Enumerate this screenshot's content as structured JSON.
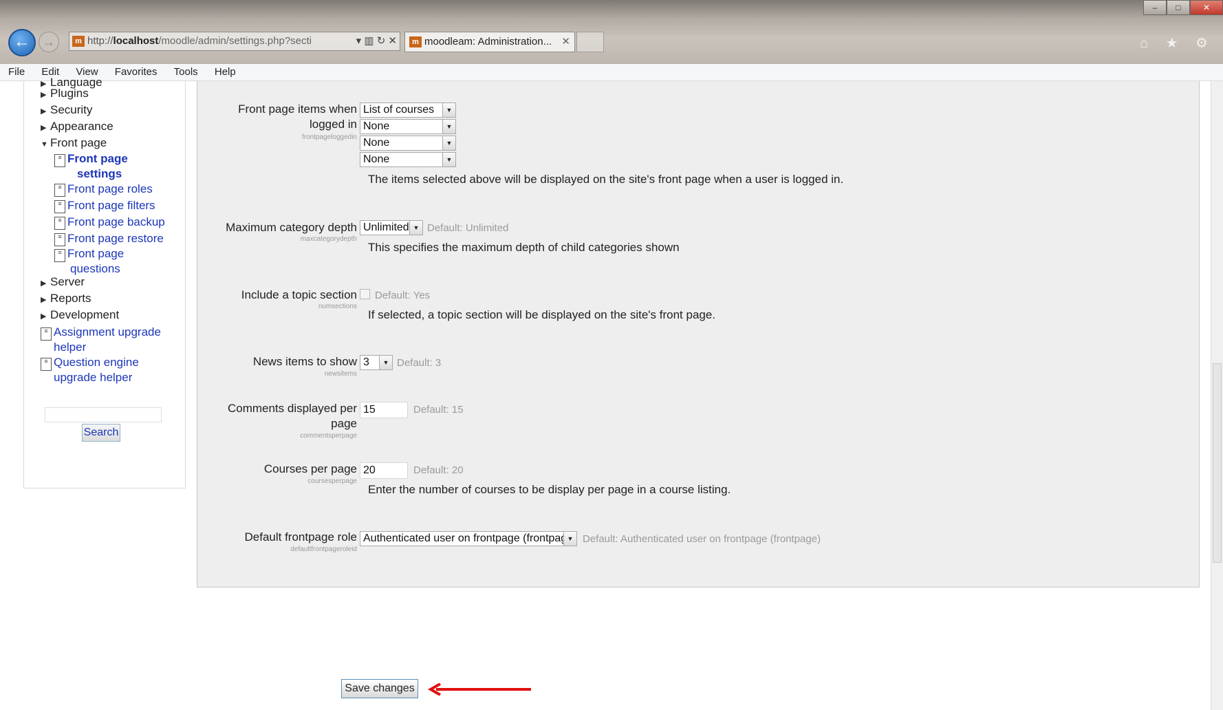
{
  "browser": {
    "address": {
      "url_prefix": "http://",
      "url_host": "localhost",
      "url_path": "/moodle/admin/settings.php?secti",
      "controls": "▾ ▥ ↻ ✕"
    },
    "tab": {
      "title": "moodleam: Administration...",
      "close": "✕"
    },
    "menu": [
      "File",
      "Edit",
      "View",
      "Favorites",
      "Tools",
      "Help"
    ],
    "tool_icons": "⌂ ★ ⚙"
  },
  "sidebar": {
    "items": [
      {
        "label": "Language"
      },
      {
        "label": "Plugins"
      },
      {
        "label": "Security"
      },
      {
        "label": "Appearance"
      },
      {
        "label": "Front page"
      },
      {
        "label": "Server"
      },
      {
        "label": "Reports"
      },
      {
        "label": "Development"
      }
    ],
    "front_page_children": [
      {
        "line1": "Front page",
        "line2": "settings"
      },
      {
        "line1": "Front page roles"
      },
      {
        "line1": "Front page filters"
      },
      {
        "line1": "Front page backup"
      },
      {
        "line1": "Front page restore"
      },
      {
        "line1": "Front page",
        "line2": "questions"
      }
    ],
    "tools": [
      {
        "line1": "Assignment upgrade",
        "line2": "helper"
      },
      {
        "line1": "Question engine",
        "line2": "upgrade helper"
      }
    ],
    "search_button": "Search"
  },
  "settings": {
    "frontpage_loggedin": {
      "label_line1": "Front page items when",
      "label_line2": "logged in",
      "name": "frontpageloggedin",
      "values": [
        "List of courses",
        "None",
        "None",
        "None"
      ],
      "description": "The items selected above will be displayed on the site's front page when a user is logged in."
    },
    "max_category_depth": {
      "label": "Maximum category depth",
      "name": "maxcategorydepth",
      "value": "Unlimited",
      "default": "Default: Unlimited",
      "description": "This specifies the maximum depth of child categories shown"
    },
    "topic_section": {
      "label": "Include a topic section",
      "name": "numsections",
      "checked": false,
      "default": "Default: Yes",
      "description": "If selected, a topic section will be displayed on the site's front page."
    },
    "news_items": {
      "label": "News items to show",
      "name": "newsitems",
      "value": "3",
      "default": "Default: 3"
    },
    "comments_per_page": {
      "label_line1": "Comments displayed per",
      "label_line2": "page",
      "name": "commentsperpage",
      "value": "15",
      "default": "Default: 15"
    },
    "courses_per_page": {
      "label": "Courses per page",
      "name": "coursesperpage",
      "value": "20",
      "default": "Default: 20",
      "description": "Enter the number of courses to be display per page in a course listing."
    },
    "default_frontpage_role": {
      "label": "Default frontpage role",
      "name": "defaultfrontpageroleid",
      "value": "Authenticated user on frontpage (frontpage)",
      "default": "Default: Authenticated user on frontpage (frontpage)"
    }
  },
  "save_button": "Save changes",
  "colors": {
    "link": "#1c36b8",
    "annotation_arrow": "#e01010",
    "settings_bg": "#eeeeee"
  }
}
